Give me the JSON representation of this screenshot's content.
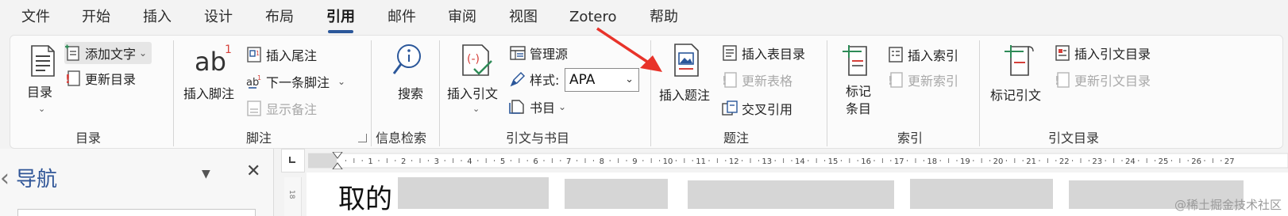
{
  "tabs": [
    "文件",
    "开始",
    "插入",
    "设计",
    "布局",
    "引用",
    "邮件",
    "审阅",
    "视图",
    "Zotero",
    "帮助"
  ],
  "active_tab_index": 5,
  "groups": {
    "toc": {
      "label": "目录",
      "toc_button": "目录",
      "add_text": "添加文字",
      "update_toc": "更新目录"
    },
    "footnotes": {
      "label": "脚注",
      "insert_footnote": "插入脚注",
      "insert_endnote": "插入尾注",
      "next_footnote": "下一条脚注",
      "show_notes": "显示备注"
    },
    "research": {
      "label": "信息检索",
      "search": "搜索"
    },
    "citations": {
      "label": "引文与书目",
      "insert_citation": "插入引文",
      "manage_sources": "管理源",
      "style_label": "样式:",
      "style_value": "APA",
      "bibliography": "书目"
    },
    "captions": {
      "label": "题注",
      "insert_caption": "插入题注",
      "insert_table_of_figures": "插入表目录",
      "update_table": "更新表格",
      "cross_reference": "交叉引用"
    },
    "index": {
      "label": "索引",
      "mark_entry": "标记条目",
      "insert_index": "插入索引",
      "update_index": "更新索引"
    },
    "toa": {
      "label": "引文目录",
      "mark_citation": "标记引文",
      "insert_toa": "插入引文目录",
      "update_toa": "更新引文目录"
    }
  },
  "nav_pane": {
    "title": "导航"
  },
  "ruler_numbers": [
    "1",
    "2",
    "3",
    "4",
    "5",
    "6",
    "7",
    "8",
    "9",
    "10",
    "11",
    "12",
    "13",
    "14",
    "15",
    "16",
    "17",
    "18",
    "19",
    "20",
    "21",
    "22",
    "23",
    "24",
    "25",
    "26",
    "27"
  ],
  "vertical_ruler_label": "18",
  "document": {
    "visible_text": "取的"
  },
  "watermark": "@稀土掘金技术社区",
  "colors": {
    "accent": "#2b579a",
    "nav_title": "#2f5597",
    "annotation_arrow": "#e8332a",
    "icon_red": "#d6403a",
    "icon_green": "#2e8b57"
  }
}
